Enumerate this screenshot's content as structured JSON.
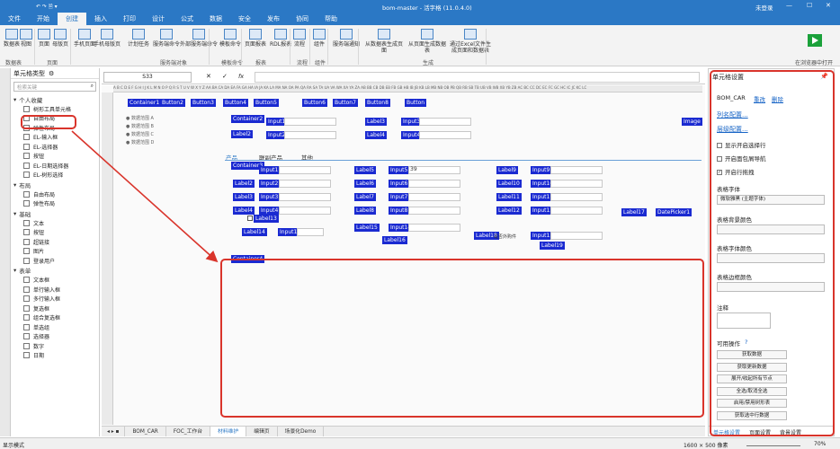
{
  "title": "bom-master - 活字格 (11.0.4.0)",
  "user": "未登录",
  "menu": [
    "文件",
    "开始",
    "创建",
    "插入",
    "打印",
    "设计",
    "公式",
    "数据",
    "安全",
    "发布",
    "协同",
    "帮助"
  ],
  "menu_active": 2,
  "ribbon": {
    "buttons": [
      "数据表",
      "视图",
      "页面",
      "母版页",
      "手机页面",
      "手机母版页",
      "计划任务",
      "服务端命令",
      "外部服务端命令",
      "模板命令",
      "页面报表",
      "RDL报表",
      "流程",
      "组件",
      "服务端通知",
      "从数据表生成页面",
      "从页面生成数据表",
      "通过Excel文件生成页面和数据表"
    ],
    "groups": [
      "数据表",
      "页面",
      "服务端对象",
      "模板命令",
      "报表",
      "流程",
      "组件",
      "生成"
    ],
    "run_label": "在浏览器中打开"
  },
  "left_panel": {
    "title": "单元格类型",
    "search_placeholder": "检索关键",
    "groups": [
      {
        "name": "个人收藏",
        "items": [
          "树形工具单元格",
          "自由布局",
          "弹性布局",
          "EL-输入框",
          "EL-选择器",
          "按钮",
          "EL-日期选择器",
          "EL-树形选择"
        ]
      },
      {
        "name": "布局",
        "items": [
          "自由布局",
          "弹性布局"
        ]
      },
      {
        "name": "基础",
        "items": [
          "文本",
          "按钮",
          "超链接",
          "图片",
          "登录用户"
        ]
      },
      {
        "name": "表单",
        "items": [
          "文本框",
          "单行输入框",
          "多行输入框",
          "复选框",
          "组合复选框",
          "单选组",
          "选择器",
          "数字",
          "日期"
        ]
      }
    ]
  },
  "formula": {
    "cell_ref": "S33",
    "fx": "fx"
  },
  "canvas": {
    "row1": [
      "Container1",
      "Button2",
      "Button3",
      "Button4",
      "Button5",
      "Button6",
      "Button7",
      "Button8",
      "Button"
    ],
    "tree_items": [
      "● 数据范围 A",
      "● 数据范围 B",
      "● 数据范围 C",
      "● 数据范围 D"
    ],
    "container2": "Container2",
    "labels_top": [
      "Label2",
      "Input1",
      "Input2",
      "Label3",
      "Label4",
      "Input3",
      "Input4",
      "Image"
    ],
    "tabs": [
      "产品",
      "联副产品",
      "其他"
    ],
    "container3": "Container3",
    "grid_cells": [
      "Input1",
      "Input2",
      "Input3",
      "Input4",
      "Label1",
      "Label2",
      "Label3",
      "Label4",
      "Label5",
      "Label6",
      "Label7",
      "Label8",
      "Label9",
      "Label10",
      "Label11",
      "Label12",
      "Input5",
      "Input6",
      "Input7",
      "Input8",
      "Input9",
      "Input10",
      "Input11",
      "Input12",
      "Label13",
      "Label14",
      "Input13",
      "Label15",
      "Input14",
      "Label16",
      "Label18",
      "Input15",
      "Label19",
      "Label17",
      "DatePicker1"
    ],
    "input5_value": "39",
    "checkbox_text": "是否外购件",
    "container4": "Container4"
  },
  "bottom_tabs": [
    "BOM_CAR",
    "FOC_工作台",
    "材料维护",
    "编辑页",
    "场景化Demo"
  ],
  "bottom_active": 2,
  "right_panel": {
    "title": "单元格设置",
    "name": "BOM_CAR",
    "rename": "重改",
    "delete": "删除",
    "link1": "列名配置...",
    "link2": "层级配置...",
    "checkboxes": [
      "显示开启选择行",
      "开启面包屑导航",
      "开启行拖拽"
    ],
    "font_label": "表格字体",
    "font_value": "微软雅黑 (主题字体)",
    "bgcolor_label": "表格背景颜色",
    "fontcolor_label": "表格字体颜色",
    "bordercolor_label": "表格边框颜色",
    "note_label": "注释",
    "ops_label": "可用操作",
    "ops": [
      "获取数据",
      "获取更新数据",
      "展开/收起所有节点",
      "全选/取消全选",
      "启用/禁用树形表",
      "获取选中行数据"
    ],
    "tabs": [
      "单元格设置",
      "页面设置",
      "背景设置"
    ]
  },
  "status": {
    "mode": "显示模式",
    "size": "1600 × 500 像素",
    "zoom": "70%"
  },
  "colors": {
    "brand": "#2b78c5",
    "component": "#1a2ad1",
    "highlight": "#d9342b"
  }
}
